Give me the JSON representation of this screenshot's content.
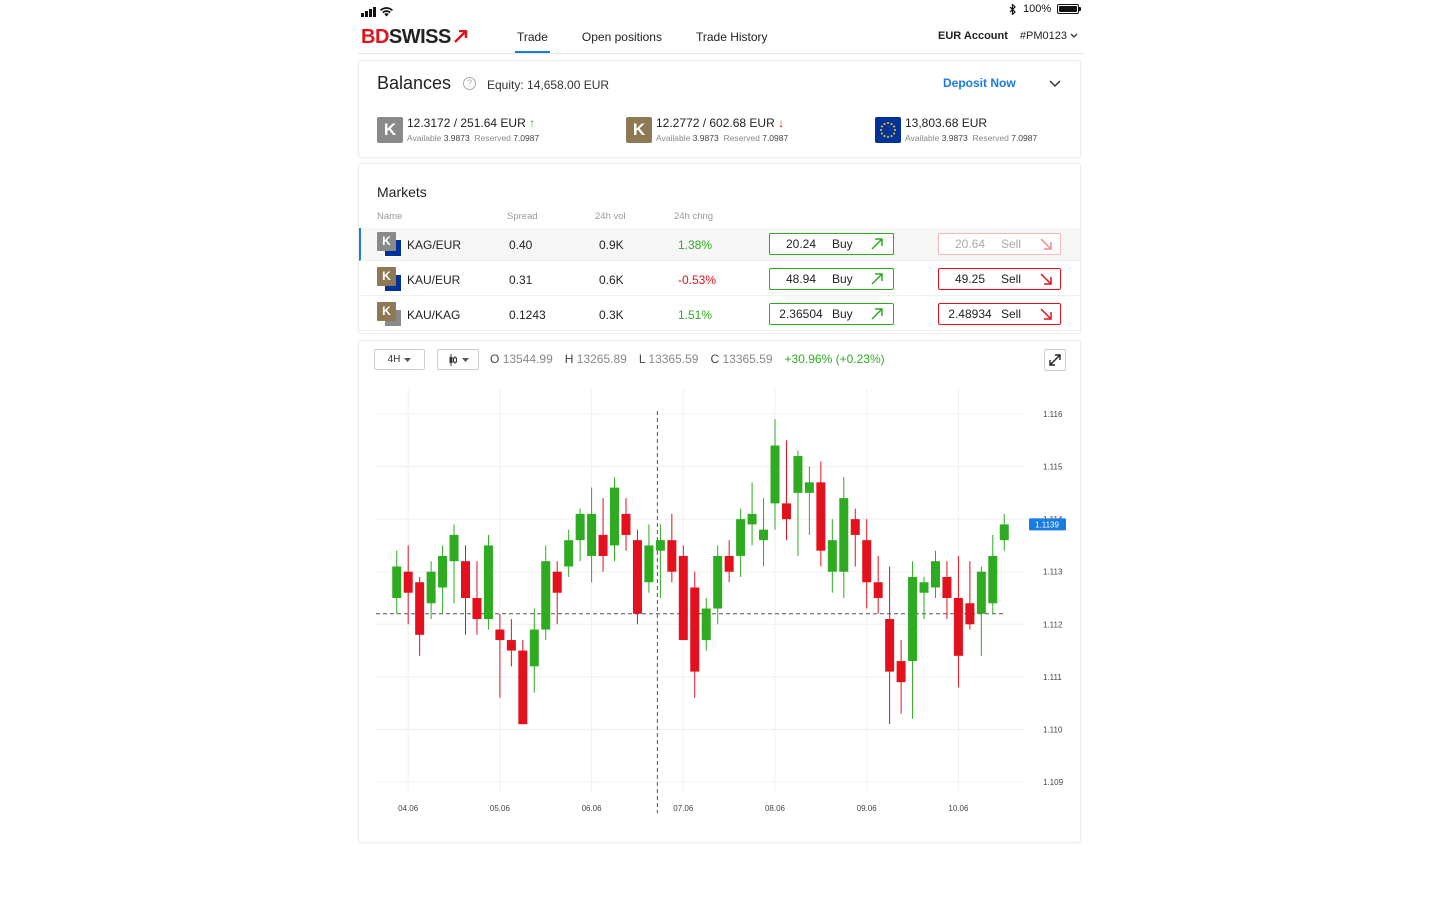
{
  "status": {
    "battery_text": "100%",
    "battery_level": 1.0
  },
  "brand": {
    "bd": "BD",
    "swiss": "SWISS",
    "red": "#e3111d"
  },
  "nav": {
    "tabs": [
      {
        "label": "Trade",
        "active": true
      },
      {
        "label": "Open positions"
      },
      {
        "label": "Trade History"
      }
    ]
  },
  "account": {
    "name": "EUR Account",
    "id": "#PM0123"
  },
  "balances": {
    "title": "Balances",
    "equity": "Equity: 14,658.00 EUR",
    "deposit_label": "Deposit Now",
    "assets": [
      {
        "amount": "12.3172  /  251.64 EUR",
        "trend": "up",
        "available_label": "Available",
        "available": "3.9873",
        "reserved_label": "Reserved",
        "reserved": "7.0987",
        "icon": "kag-icon",
        "color": "#8a8a8a"
      },
      {
        "amount": "12.2772  /  602.68 EUR",
        "trend": "down",
        "available_label": "Available",
        "available": "3.9873",
        "reserved_label": "Reserved",
        "reserved": "7.0987",
        "icon": "kau-icon",
        "color": "#8d7a55"
      },
      {
        "amount": "13,803.68 EUR",
        "trend": "",
        "available_label": "Available",
        "available": "3.9873",
        "reserved_label": "Reserved",
        "reserved": "7.0987",
        "icon": "eur-flag-icon",
        "color": "#003399"
      }
    ]
  },
  "markets": {
    "title": "Markets",
    "columns": {
      "name": "Name",
      "spread": "Spread",
      "vol": "24h vol",
      "chng": "24h chng"
    },
    "rows": [
      {
        "name": "KAG/EUR",
        "spread": "0.40",
        "vol": "0.9K",
        "chng": "1.38%",
        "dir": "pos",
        "buy": "20.24",
        "sell": "20.64",
        "buy_label": "Buy",
        "sell_label": "Sell",
        "selected": true,
        "base": "#8a8a8a",
        "quote": "#003399"
      },
      {
        "name": "KAU/EUR",
        "spread": "0.31",
        "vol": "0.6K",
        "chng": "-0.53%",
        "dir": "neg",
        "buy": "48.94",
        "sell": "49.25",
        "buy_label": "Buy",
        "sell_label": "Sell",
        "selected": false,
        "base": "#8d7a55",
        "quote": "#003399"
      },
      {
        "name": "KAU/KAG",
        "spread": "0.1243",
        "vol": "0.3K",
        "chng": "1.51%",
        "dir": "pos",
        "buy": "2.36504",
        "sell": "2.48934",
        "buy_label": "Buy",
        "sell_label": "Sell",
        "selected": false,
        "base": "#8d7a55",
        "quote": "#8a8a8a"
      }
    ]
  },
  "toolbar": {
    "interval": "4H",
    "ohlc": [
      {
        "k": "O",
        "v": "13544.99"
      },
      {
        "k": "H",
        "v": "13265.89"
      },
      {
        "k": "L",
        "v": "13365.59"
      },
      {
        "k": "C",
        "v": "13365.59"
      }
    ],
    "change": "+30.96% (+0.23%)"
  },
  "chart_data": {
    "type": "candlestick",
    "y_ticks": [
      "1.116",
      "1.115",
      "1.114",
      "1.113",
      "1.112",
      "1.111",
      "1.110",
      "1.109"
    ],
    "ylim": [
      1.1085,
      1.1165
    ],
    "x_ticks": [
      "04.06",
      "05.06",
      "06.06",
      "07.06",
      "08.06",
      "09.06",
      "10.06"
    ],
    "last_price": "1.1139",
    "up_color": "#2eab21",
    "down_color": "#e3111d",
    "crosshair": {
      "x_candle": 23,
      "y": 1.1122
    },
    "candles": [
      {
        "o": 1.1125,
        "h": 1.1134,
        "l": 1.1122,
        "c": 1.1131
      },
      {
        "o": 1.113,
        "h": 1.1135,
        "l": 1.112,
        "c": 1.1126
      },
      {
        "o": 1.1128,
        "h": 1.1129,
        "l": 1.1114,
        "c": 1.1118
      },
      {
        "o": 1.1124,
        "h": 1.1132,
        "l": 1.1121,
        "c": 1.113
      },
      {
        "o": 1.1127,
        "h": 1.1135,
        "l": 1.1122,
        "c": 1.1133
      },
      {
        "o": 1.1132,
        "h": 1.1139,
        "l": 1.1124,
        "c": 1.1137
      },
      {
        "o": 1.1132,
        "h": 1.1135,
        "l": 1.1118,
        "c": 1.1125
      },
      {
        "o": 1.1125,
        "h": 1.1132,
        "l": 1.1118,
        "c": 1.1121
      },
      {
        "o": 1.1121,
        "h": 1.1137,
        "l": 1.1119,
        "c": 1.1135
      },
      {
        "o": 1.1119,
        "h": 1.1122,
        "l": 1.1106,
        "c": 1.1117
      },
      {
        "o": 1.1117,
        "h": 1.1121,
        "l": 1.1112,
        "c": 1.1115
      },
      {
        "o": 1.1115,
        "h": 1.1117,
        "l": 1.1103,
        "c": 1.1101
      },
      {
        "o": 1.1112,
        "h": 1.1123,
        "l": 1.1107,
        "c": 1.1119
      },
      {
        "o": 1.1119,
        "h": 1.1135,
        "l": 1.1117,
        "c": 1.1132
      },
      {
        "o": 1.113,
        "h": 1.1132,
        "l": 1.112,
        "c": 1.1126
      },
      {
        "o": 1.1131,
        "h": 1.1138,
        "l": 1.1129,
        "c": 1.1136
      },
      {
        "o": 1.1136,
        "h": 1.1142,
        "l": 1.1132,
        "c": 1.1141
      },
      {
        "o": 1.1133,
        "h": 1.1146,
        "l": 1.1128,
        "c": 1.1141
      },
      {
        "o": 1.1137,
        "h": 1.1144,
        "l": 1.113,
        "c": 1.1133
      },
      {
        "o": 1.1135,
        "h": 1.1148,
        "l": 1.1132,
        "c": 1.1146
      },
      {
        "o": 1.1141,
        "h": 1.1144,
        "l": 1.1134,
        "c": 1.1137
      },
      {
        "o": 1.1136,
        "h": 1.1138,
        "l": 1.112,
        "c": 1.1122
      },
      {
        "o": 1.1128,
        "h": 1.1139,
        "l": 1.1126,
        "c": 1.1135
      },
      {
        "o": 1.1134,
        "h": 1.1139,
        "l": 1.1125,
        "c": 1.1136
      },
      {
        "o": 1.1136,
        "h": 1.1141,
        "l": 1.1128,
        "c": 1.113
      },
      {
        "o": 1.1133,
        "h": 1.1135,
        "l": 1.1119,
        "c": 1.1117
      },
      {
        "o": 1.1127,
        "h": 1.113,
        "l": 1.1106,
        "c": 1.1111
      },
      {
        "o": 1.1117,
        "h": 1.1125,
        "l": 1.1115,
        "c": 1.1123
      },
      {
        "o": 1.1123,
        "h": 1.1135,
        "l": 1.112,
        "c": 1.1133
      },
      {
        "o": 1.1133,
        "h": 1.1136,
        "l": 1.1128,
        "c": 1.113
      },
      {
        "o": 1.1133,
        "h": 1.1142,
        "l": 1.1129,
        "c": 1.114
      },
      {
        "o": 1.1139,
        "h": 1.1147,
        "l": 1.1135,
        "c": 1.1141
      },
      {
        "o": 1.1136,
        "h": 1.1144,
        "l": 1.1131,
        "c": 1.1138
      },
      {
        "o": 1.1143,
        "h": 1.1159,
        "l": 1.1138,
        "c": 1.1154
      },
      {
        "o": 1.1143,
        "h": 1.1155,
        "l": 1.1136,
        "c": 1.114
      },
      {
        "o": 1.1145,
        "h": 1.1153,
        "l": 1.1133,
        "c": 1.1152
      },
      {
        "o": 1.1145,
        "h": 1.115,
        "l": 1.1137,
        "c": 1.1147
      },
      {
        "o": 1.1147,
        "h": 1.1151,
        "l": 1.1131,
        "c": 1.1134
      },
      {
        "o": 1.113,
        "h": 1.114,
        "l": 1.1126,
        "c": 1.1136
      },
      {
        "o": 1.113,
        "h": 1.1148,
        "l": 1.1125,
        "c": 1.1144
      },
      {
        "o": 1.114,
        "h": 1.1142,
        "l": 1.1131,
        "c": 1.1137
      },
      {
        "o": 1.1136,
        "h": 1.114,
        "l": 1.1123,
        "c": 1.1128
      },
      {
        "o": 1.1128,
        "h": 1.1133,
        "l": 1.1122,
        "c": 1.1125
      },
      {
        "o": 1.1121,
        "h": 1.1131,
        "l": 1.1101,
        "c": 1.1111
      },
      {
        "o": 1.1113,
        "h": 1.1117,
        "l": 1.1103,
        "c": 1.1109
      },
      {
        "o": 1.1113,
        "h": 1.1132,
        "l": 1.1102,
        "c": 1.1129
      },
      {
        "o": 1.1126,
        "h": 1.1129,
        "l": 1.1121,
        "c": 1.1128
      },
      {
        "o": 1.1127,
        "h": 1.1134,
        "l": 1.1125,
        "c": 1.1132
      },
      {
        "o": 1.1129,
        "h": 1.1132,
        "l": 1.1121,
        "c": 1.1125
      },
      {
        "o": 1.1125,
        "h": 1.1133,
        "l": 1.1108,
        "c": 1.1114
      },
      {
        "o": 1.1124,
        "h": 1.1132,
        "l": 1.1119,
        "c": 1.112
      },
      {
        "o": 1.1122,
        "h": 1.1131,
        "l": 1.1114,
        "c": 1.113
      },
      {
        "o": 1.1124,
        "h": 1.1137,
        "l": 1.1122,
        "c": 1.1133
      },
      {
        "o": 1.1136,
        "h": 1.1141,
        "l": 1.1134,
        "c": 1.1139
      }
    ]
  }
}
